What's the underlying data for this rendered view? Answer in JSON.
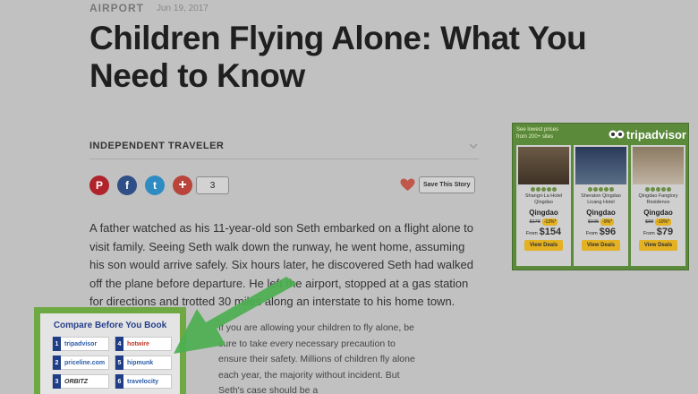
{
  "meta": {
    "category": "AIRPORT",
    "date": "Jun 19, 2017"
  },
  "headline": "Children Flying Alone: What You Need to Know",
  "source": {
    "name": "INDEPENDENT TRAVELER"
  },
  "share": {
    "pinterest": "P",
    "facebook": "f",
    "twitter": "t",
    "plus": "+",
    "count": "3",
    "save_label": "Save This Story"
  },
  "article": {
    "paragraph1": "A father watched as his 11-year-old son Seth embarked on a flight alone to visit family. Seeing Seth walk down the runway, he went home, assuming his son would arrive safely. Six hours later, he discovered Seth had walked off the plane before departure. He left the airport, stopped at a gas station for directions and trotted 30 miles along an interstate to his home town.",
    "paragraph2": "If you are allowing your children to fly alone, be sure to take every necessary precaution to ensure their safety. Millions of children fly alone each year, the majority without incident. But Seth's case should be a"
  },
  "ad": {
    "see_line1": "See lowest prices",
    "see_line2": "from 200+ sites",
    "brand": "tripadvisor",
    "hotels": [
      {
        "name": "Shangri-La Hotel Qingdao",
        "city": "Qingdao",
        "old_price": "$178",
        "discount": "-13%*",
        "from": "From",
        "price": "$154",
        "button": "View Deals"
      },
      {
        "name": "Sheraton Qingdao Licang Hotel",
        "city": "Qingdao",
        "old_price": "$105",
        "discount": "-9%*",
        "from": "From",
        "price": "$96",
        "button": "View Deals"
      },
      {
        "name": "Qingdao Fangtory Residence",
        "city": "Qingdao",
        "old_price": "$88",
        "discount": "-10%*",
        "from": "From",
        "price": "$79",
        "button": "View Deals"
      }
    ]
  },
  "compare": {
    "title": "Compare Before You Book",
    "items": [
      {
        "num": "1",
        "name": "tripadvisor"
      },
      {
        "num": "4",
        "name": "hotwire"
      },
      {
        "num": "2",
        "name": "priceline.com"
      },
      {
        "num": "5",
        "name": "hipmunk"
      },
      {
        "num": "3",
        "name": "ORBITZ"
      },
      {
        "num": "6",
        "name": "travelocity"
      }
    ]
  },
  "colors": {
    "background": "#c1c1c1",
    "highlight_green": "#6fa944",
    "arrow_green": "#4caf50"
  }
}
